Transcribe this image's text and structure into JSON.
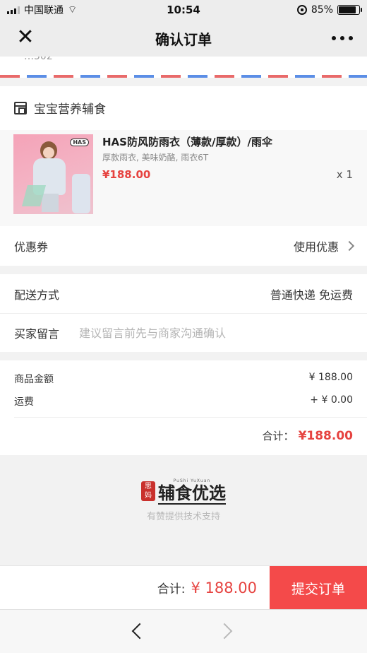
{
  "status_bar": {
    "carrier": "中国联通",
    "time": "10:54",
    "battery": "85%",
    "battery_level": 0.85
  },
  "header": {
    "title": "确认订单",
    "close_icon": "close-icon",
    "more_icon": "more-icon"
  },
  "address": {
    "peek_text": "…502"
  },
  "shop": {
    "name": "宝宝营养辅食",
    "icon": "shop-icon"
  },
  "product": {
    "title": "HAS防风防雨衣（薄款/厚款）/雨伞",
    "spec": "厚款雨衣, 美味奶酪, 雨衣6T",
    "price": "¥188.00",
    "qty": "x 1",
    "image_brand": "HAS"
  },
  "coupon": {
    "label": "优惠券",
    "action": "使用优惠"
  },
  "delivery": {
    "label": "配送方式",
    "value": "普通快递 免运费"
  },
  "note": {
    "label": "买家留言",
    "placeholder": "建议留言前先与商家沟通确认"
  },
  "summary": {
    "goods_label": "商品金额",
    "goods_value": "¥ 188.00",
    "shipping_label": "运费",
    "shipping_value": "+ ¥ 0.00",
    "total_label": "合计：",
    "total_value": "¥188.00"
  },
  "brand": {
    "seal_top": "思",
    "seal_bottom": "妈",
    "sub": "PuShi YuXuan",
    "name": "辅食优选",
    "support": "有赞提供技术支持"
  },
  "bottom_bar": {
    "total_label": "合计:",
    "total_value": "¥ 188.00",
    "submit_label": "提交订单"
  },
  "colors": {
    "accent_red": "#e64340",
    "submit_bg": "#f44a4a",
    "envelope_red": "#e96a6a",
    "envelope_blue": "#5b8ee6"
  }
}
